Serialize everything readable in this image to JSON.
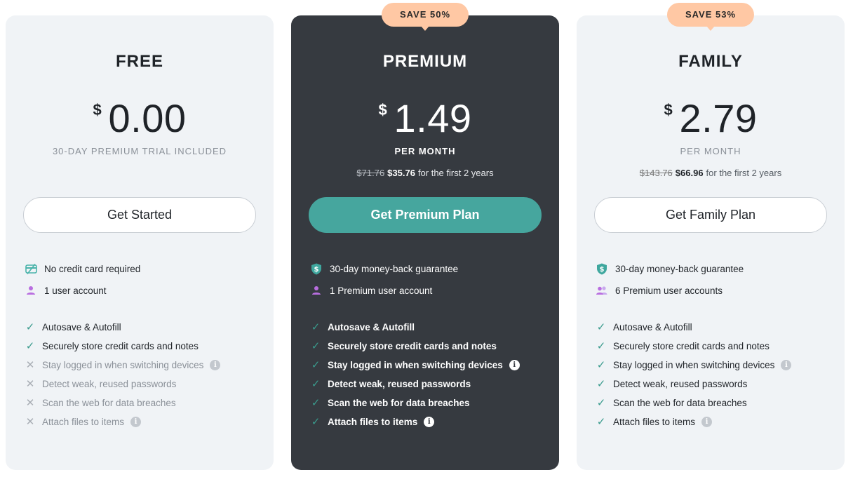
{
  "plans": [
    {
      "name": "FREE",
      "currency": "$",
      "amount": "0.00",
      "note": "30-DAY PREMIUM TRIAL INCLUDED",
      "cta": "Get Started",
      "perks": [
        {
          "icon": "no-card-icon",
          "text": "No credit card required"
        },
        {
          "icon": "user-icon",
          "text": "1 user account"
        }
      ],
      "features": [
        {
          "status": "check",
          "text": "Autosave & Autofill"
        },
        {
          "status": "check",
          "text": "Securely store credit cards and notes"
        },
        {
          "status": "cross",
          "text": "Stay logged in when switching devices",
          "info": "i"
        },
        {
          "status": "cross",
          "text": "Detect weak, reused passwords"
        },
        {
          "status": "cross",
          "text": "Scan the web for data breaches"
        },
        {
          "status": "cross",
          "text": "Attach files to items",
          "info": "i"
        }
      ]
    },
    {
      "name": "PREMIUM",
      "badge": "SAVE 50%",
      "currency": "$",
      "amount": "1.49",
      "note": "PER MONTH",
      "old_price": "$71.76",
      "new_price": "$35.76",
      "discount_suffix": "for the first 2 years",
      "cta": "Get Premium Plan",
      "perks": [
        {
          "icon": "shield-dollar-icon",
          "text": "30-day money-back guarantee"
        },
        {
          "icon": "user-icon",
          "text": "1 Premium user account"
        }
      ],
      "features": [
        {
          "status": "check",
          "text": "Autosave & Autofill"
        },
        {
          "status": "check",
          "text": "Securely store credit cards and notes"
        },
        {
          "status": "check",
          "text": "Stay logged in when switching devices",
          "info": "i"
        },
        {
          "status": "check",
          "text": "Detect weak, reused passwords"
        },
        {
          "status": "check",
          "text": "Scan the web for data breaches"
        },
        {
          "status": "check",
          "text": "Attach files to items",
          "info": "i"
        }
      ]
    },
    {
      "name": "FAMILY",
      "badge": "SAVE 53%",
      "currency": "$",
      "amount": "2.79",
      "note": "PER MONTH",
      "old_price": "$143.76",
      "new_price": "$66.96",
      "discount_suffix": "for the first 2 years",
      "cta": "Get Family Plan",
      "perks": [
        {
          "icon": "shield-dollar-icon",
          "text": "30-day money-back guarantee"
        },
        {
          "icon": "users-icon",
          "text": "6 Premium user accounts"
        }
      ],
      "features": [
        {
          "status": "check",
          "text": "Autosave & Autofill"
        },
        {
          "status": "check",
          "text": "Securely store credit cards and notes"
        },
        {
          "status": "check",
          "text": "Stay logged in when switching devices",
          "info": "i"
        },
        {
          "status": "check",
          "text": "Detect weak, reused passwords"
        },
        {
          "status": "check",
          "text": "Scan the web for data breaches"
        },
        {
          "status": "check",
          "text": "Attach files to items",
          "info": "i"
        }
      ]
    }
  ],
  "colors": {
    "accent": "#46a69e",
    "badge": "#ffc8a4",
    "dark_card": "#363a40",
    "light_card": "#f0f3f6",
    "icon_purple": "#b96ee0",
    "icon_teal": "#3fa79e"
  }
}
